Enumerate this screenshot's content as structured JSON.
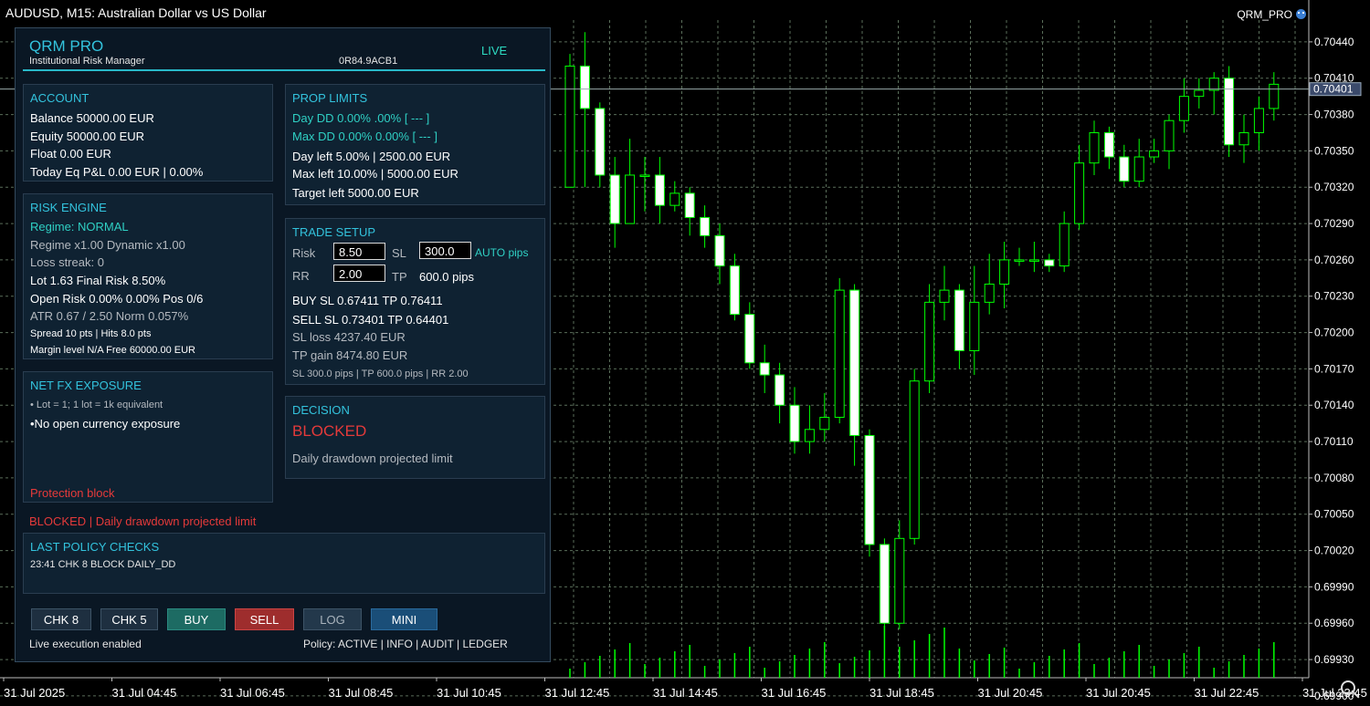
{
  "window": {
    "title": "AUDUSD, M15:  Australian Dollar vs US Dollar",
    "expert_name": "QRM_PRO"
  },
  "chart_data": {
    "type": "candlestick",
    "symbol": "AUDUSD",
    "timeframe": "M15",
    "ylim": [
      0.69915,
      0.70458
    ],
    "price_ticks": [
      "0.70440",
      "0.70410",
      "0.70380",
      "0.70350",
      "0.70320",
      "0.70290",
      "0.70260",
      "0.70230",
      "0.70200",
      "0.70170",
      "0.70140",
      "0.70110",
      "0.70080",
      "0.70050",
      "0.70020",
      "0.69990",
      "0.69960",
      "0.69930",
      "0.69900"
    ],
    "current_price": "0.70401",
    "time_labels": [
      "31 Jul 2025",
      "31 Jul 04:45",
      "31 Jul 06:45",
      "31 Jul 08:45",
      "31 Jul 10:45",
      "31 Jul 12:45",
      "31 Jul 14:45",
      "31 Jul 16:45",
      "31 Jul 18:45",
      "31 Jul 20:45",
      "31 Jul 20:45",
      "31 Jul 22:45",
      "31 Jul 23:45"
    ],
    "candles": [
      [
        0.7032,
        0.7042,
        0.7043,
        0.7032
      ],
      [
        0.7042,
        0.70385,
        0.70448,
        0.7032
      ],
      [
        0.70385,
        0.7033,
        0.7039,
        0.7032
      ],
      [
        0.7033,
        0.7029,
        0.70345,
        0.7027
      ],
      [
        0.7029,
        0.7033,
        0.7036,
        0.7029
      ],
      [
        0.7033,
        0.7033,
        0.70345,
        0.703
      ],
      [
        0.7033,
        0.70305,
        0.70345,
        0.7029
      ],
      [
        0.70305,
        0.70315,
        0.70325,
        0.703
      ],
      [
        0.70315,
        0.70295,
        0.7032,
        0.7028
      ],
      [
        0.70295,
        0.7028,
        0.70305,
        0.7027
      ],
      [
        0.7028,
        0.70255,
        0.7029,
        0.7024
      ],
      [
        0.70255,
        0.70215,
        0.70265,
        0.7021
      ],
      [
        0.70215,
        0.70175,
        0.70225,
        0.7017
      ],
      [
        0.70175,
        0.70165,
        0.7019,
        0.7015
      ],
      [
        0.70165,
        0.7014,
        0.70175,
        0.70125
      ],
      [
        0.7014,
        0.7011,
        0.70155,
        0.701
      ],
      [
        0.7011,
        0.7012,
        0.7014,
        0.701
      ],
      [
        0.7012,
        0.7013,
        0.7015,
        0.7011
      ],
      [
        0.7013,
        0.70235,
        0.70245,
        0.70125
      ],
      [
        0.70235,
        0.70115,
        0.7024,
        0.7009
      ],
      [
        0.70115,
        0.70025,
        0.7012,
        0.70015
      ],
      [
        0.70025,
        0.6996,
        0.7003,
        0.6995
      ],
      [
        0.6996,
        0.7003,
        0.70045,
        0.69955
      ],
      [
        0.7003,
        0.7016,
        0.7017,
        0.70025
      ],
      [
        0.7016,
        0.70225,
        0.7024,
        0.7015
      ],
      [
        0.70225,
        0.70235,
        0.70255,
        0.7021
      ],
      [
        0.70235,
        0.70185,
        0.7024,
        0.7017
      ],
      [
        0.70185,
        0.70225,
        0.70255,
        0.70165
      ],
      [
        0.70225,
        0.7024,
        0.70265,
        0.70215
      ],
      [
        0.7024,
        0.7026,
        0.70275,
        0.7022
      ],
      [
        0.7026,
        0.7026,
        0.7027,
        0.70255
      ],
      [
        0.7026,
        0.7026,
        0.70275,
        0.7025
      ],
      [
        0.7026,
        0.70255,
        0.70265,
        0.7025
      ],
      [
        0.70255,
        0.7029,
        0.703,
        0.7025
      ],
      [
        0.7029,
        0.7034,
        0.70355,
        0.70285
      ],
      [
        0.7034,
        0.70365,
        0.70375,
        0.7033
      ],
      [
        0.70365,
        0.70345,
        0.7037,
        0.70335
      ],
      [
        0.70345,
        0.70325,
        0.70355,
        0.7032
      ],
      [
        0.70325,
        0.70345,
        0.7036,
        0.7032
      ],
      [
        0.70345,
        0.7035,
        0.7036,
        0.7034
      ],
      [
        0.7035,
        0.70375,
        0.7038,
        0.70335
      ],
      [
        0.70375,
        0.70395,
        0.7041,
        0.70365
      ],
      [
        0.70395,
        0.704,
        0.7041,
        0.70385
      ],
      [
        0.704,
        0.7041,
        0.70415,
        0.7038
      ],
      [
        0.7041,
        0.70355,
        0.7042,
        0.70345
      ],
      [
        0.70355,
        0.70365,
        0.7038,
        0.7034
      ],
      [
        0.70365,
        0.70385,
        0.70395,
        0.7035
      ],
      [
        0.70385,
        0.70405,
        0.70415,
        0.70375
      ]
    ]
  },
  "panel": {
    "title": "QRM PRO",
    "subtitle": "Institutional Risk Manager",
    "id": "0R84.9ACB1",
    "status": "LIVE",
    "account": {
      "header": "ACCOUNT",
      "lines": [
        "Balance   50000.00 EUR",
        "Equity      50000.00 EUR",
        "Float      0.00 EUR",
        "Today Eq P&L 0.00 EUR | 0.00%"
      ]
    },
    "prop": {
      "header": "PROP LIMITS",
      "day_dd": "Day DD    0.00% .00%  [ --- ]",
      "max_dd": "Max DD    0.00% 0.00%  [ --- ]",
      "day_left": "Day left     5.00% | 2500.00 EUR",
      "max_left": "Max left     10.00% | 5000.00 EUR",
      "target_left": "Target left 5000.00 EUR"
    },
    "risk": {
      "header": "RISK ENGINE",
      "regime": "Regime: NORMAL",
      "regime_mult": "Regime x1.00    Dynamic x1.00",
      "loss_streak": "Loss streak: 0",
      "lot": "Lot 1.63    Final Risk 8.50%",
      "open_risk": "Open Risk 0.00% 0.00%   Pos 0/6",
      "atr": "ATR 0.67 / 2.50    Norm 0.057%",
      "spread": "Spread 10 pts | Hits 8.0 pts",
      "margin": "Margin level N/A Free 60000.00 EUR"
    },
    "trade": {
      "header": "TRADE SETUP",
      "risk_label": "Risk",
      "risk_value": "8.50",
      "sl_label": "SL",
      "sl_value": "300.0",
      "auto": "AUTO pips",
      "rr_label": "RR",
      "rr_value": "2.00",
      "tp_label": "TP",
      "tp_value": "600.0 pips",
      "buy": "BUY   SL 0.67411    TP 0.76411",
      "sell": "SELL  SL 0.73401    TP 0.64401",
      "sl_loss": "SL loss 4237.40 EUR",
      "tp_gain": "TP gain 8474.80 EUR",
      "summary": "SL 300.0 pips | TP 600.0 pips | RR 2.00"
    },
    "exposure": {
      "header": "NET FX EXPOSURE",
      "note": "• Lot = 1;  1 lot = 1k equivalent",
      "line": "•No open currency exposure",
      "protection": "Protection block"
    },
    "decision": {
      "header": "DECISION",
      "status": "BLOCKED",
      "reason": "Daily drawdown projected limit"
    },
    "blocked_line": "BLOCKED | Daily drawdown projected limit",
    "policy": {
      "header": "LAST POLICY CHECKS",
      "line": "23:41 CHK 8 BLOCK DAILY_DD"
    },
    "buttons": [
      "CHK 8",
      "CHK 5",
      "BUY",
      "SELL",
      "LOG",
      "MINI"
    ],
    "footer_left": "Live execution enabled",
    "footer_right": "Policy: ACTIVE | INFO | AUDIT | LEDGER"
  },
  "colors": {
    "bull": "#00ff00",
    "bear_body": "#ffffff",
    "grid": "#5a6e5a",
    "accent": "#33c3dd",
    "blocked": "#e53a3a",
    "buy": "#1d6b63",
    "sell": "#9e2d2d"
  }
}
